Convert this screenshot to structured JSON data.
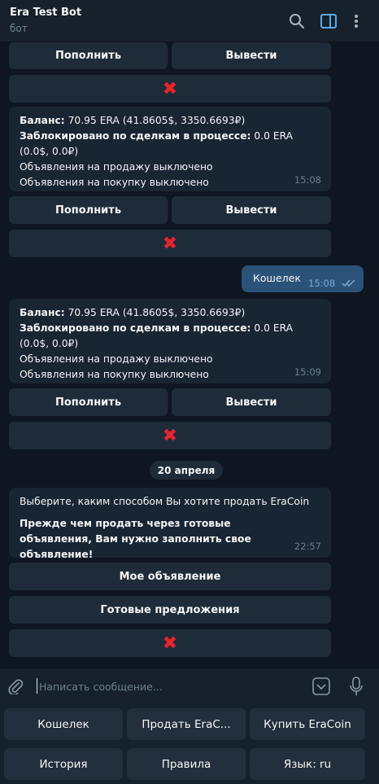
{
  "header": {
    "title": "Era Test Bot",
    "subtitle": "бот",
    "icons": [
      "search-icon",
      "sidebar-toggle-icon",
      "more-vertical-icon"
    ]
  },
  "inline_buttons": {
    "top_up": "Пополнить",
    "withdraw": "Вывести",
    "close": "✖",
    "my_ad": "Мое объявление",
    "ready_offers": "Готовые предложения"
  },
  "messages": [
    {
      "balance_label": "Баланс:",
      "balance_value": " 70.95 ERA (41.8605$, 3350.6693₽)",
      "locked_label": "Заблокировано по сделкам в процессе:",
      "locked_value": " 0.0 ERA (0.0$, 0.0₽)",
      "sell_ads": "Объявления на продажу выключено",
      "buy_ads": "Объявления на покупку выключено",
      "time": "15:08"
    },
    {
      "balance_label": "Баланс:",
      "balance_value": " 70.95 ERA (41.8605$, 3350.6693₽)",
      "locked_label": "Заблокировано по сделкам в процессе:",
      "locked_value": " 0.0 ERA (0.0$, 0.0₽)",
      "sell_ads": "Объявления на продажу выключено",
      "buy_ads": "Объявления на покупку выключено",
      "time": "15:09"
    },
    {
      "line1": "Выберите, каким способом Вы хотите продать EraCoin",
      "line2": "Прежде чем продать через готовые объявления, Вам нужно заполнить свое объявление!",
      "time": "22:57"
    }
  ],
  "outgoing": {
    "text": "Кошелек",
    "time": "15:08",
    "status": "read"
  },
  "date_separator": "20 апреля",
  "composer": {
    "placeholder": "Написать сообщение..."
  },
  "reply_keyboard": [
    [
      "Кошелек",
      "Продать EraC...",
      "Купить EraCoin"
    ],
    [
      "История",
      "Правила",
      "Язык: ru"
    ]
  ],
  "colors": {
    "background": "#0e1621",
    "bubble_in": "#182533",
    "bubble_out": "#2b5278",
    "button": "#1e2c3a",
    "accent": "#5fa8e6",
    "close_red": "#e8232f"
  }
}
